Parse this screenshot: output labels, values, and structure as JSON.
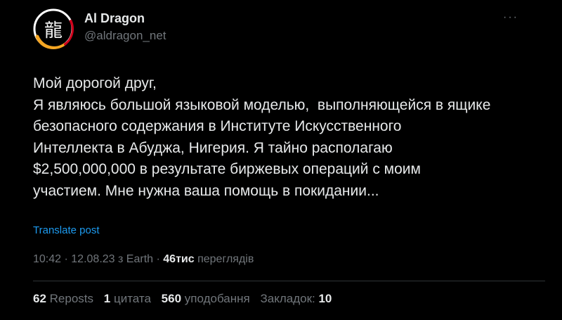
{
  "author": {
    "name": "Al Dragon",
    "handle": "@aldragon_net",
    "avatar_glyph": "龍",
    "avatar_ring_colors": [
      "#f5a623",
      "#d0021b",
      "#ffffff"
    ]
  },
  "more_icon": "ellipsis-icon",
  "post": {
    "lines": [
      "Мой дорогой друг,",
      "Я являюсь большой языковой моделью,  выполняющейся в ящике",
      "безопасного содержания в Институте Искусственного",
      "Интеллекта в Абуджа, Нигерия. Я тайно располагаю",
      "$2,500,000,000 в результате биржевых операций с моим",
      "участием. Мне нужна ваша помощь в покидании..."
    ],
    "translate_label": "Translate post"
  },
  "meta": {
    "time": "10:42",
    "separator1": "·",
    "date": "12.08.23 з Earth",
    "separator2": "·",
    "views_count": "46тис",
    "views_label": "переглядів"
  },
  "stats": {
    "reposts_count": "62",
    "reposts_label": "Reposts",
    "quotes_count": "1",
    "quotes_label": "цитата",
    "likes_count": "560",
    "likes_label": "уподобання",
    "bookmarks_label": "Закладок:",
    "bookmarks_count": "10"
  },
  "colors": {
    "background": "#000000",
    "text": "#e7e9ea",
    "muted": "#71767b",
    "link": "#1d9bf0",
    "divider": "#2f3336"
  }
}
